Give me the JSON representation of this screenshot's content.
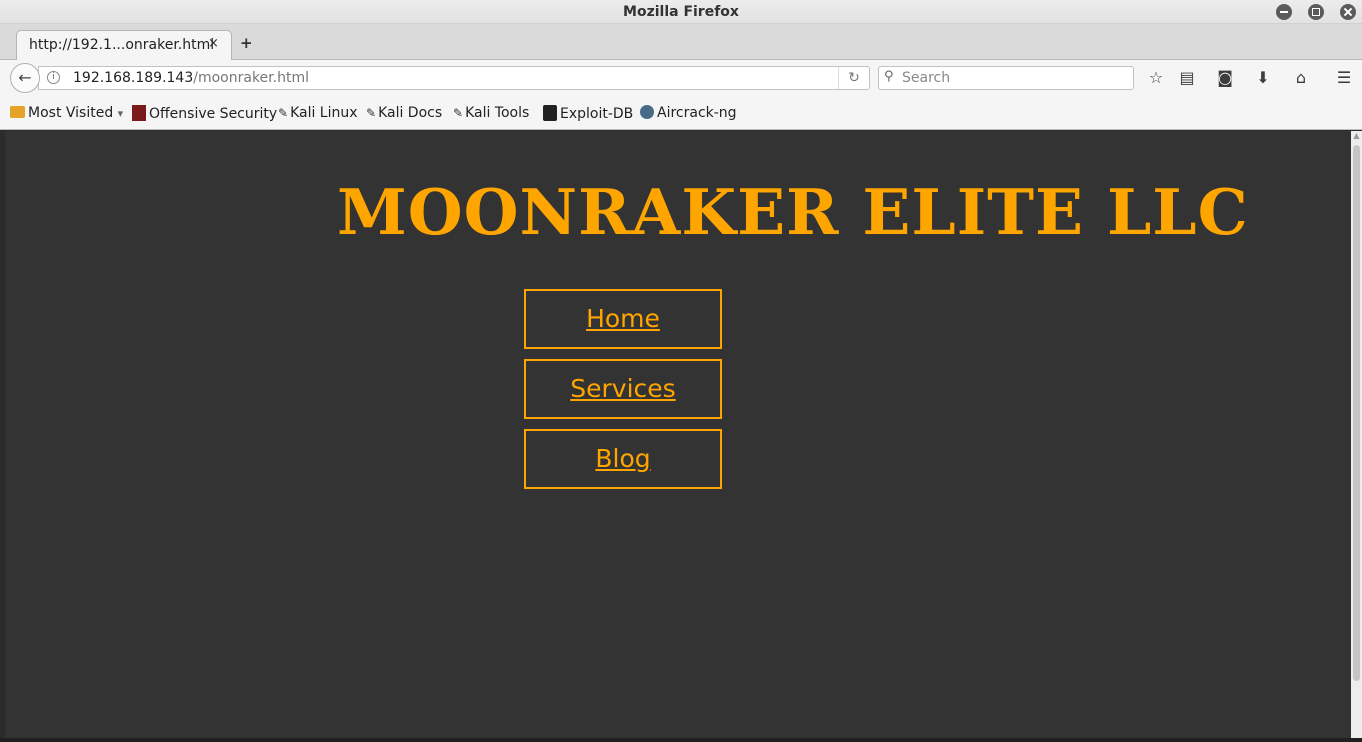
{
  "window": {
    "title": "Mozilla Firefox"
  },
  "tab": {
    "label": "http://192.1...onraker.html",
    "close": "×",
    "new": "+"
  },
  "navbar": {
    "url_host": "192.168.189.143",
    "url_path": "/moonraker.html",
    "reload": "↻",
    "search_placeholder": "Search"
  },
  "bookmarks": [
    {
      "label": "Most Visited",
      "suffix": "▾"
    },
    {
      "label": "Offensive Security"
    },
    {
      "label": "Kali Linux"
    },
    {
      "label": "Kali Docs"
    },
    {
      "label": "Kali Tools"
    },
    {
      "label": "Exploit-DB"
    },
    {
      "label": "Aircrack-ng"
    }
  ],
  "page": {
    "title": "MOONRAKER ELITE LLC",
    "nav": [
      {
        "label": "Home"
      },
      {
        "label": "Services"
      },
      {
        "label": "Blog"
      }
    ]
  },
  "colors": {
    "accent": "#ffa500",
    "background": "#333333"
  }
}
